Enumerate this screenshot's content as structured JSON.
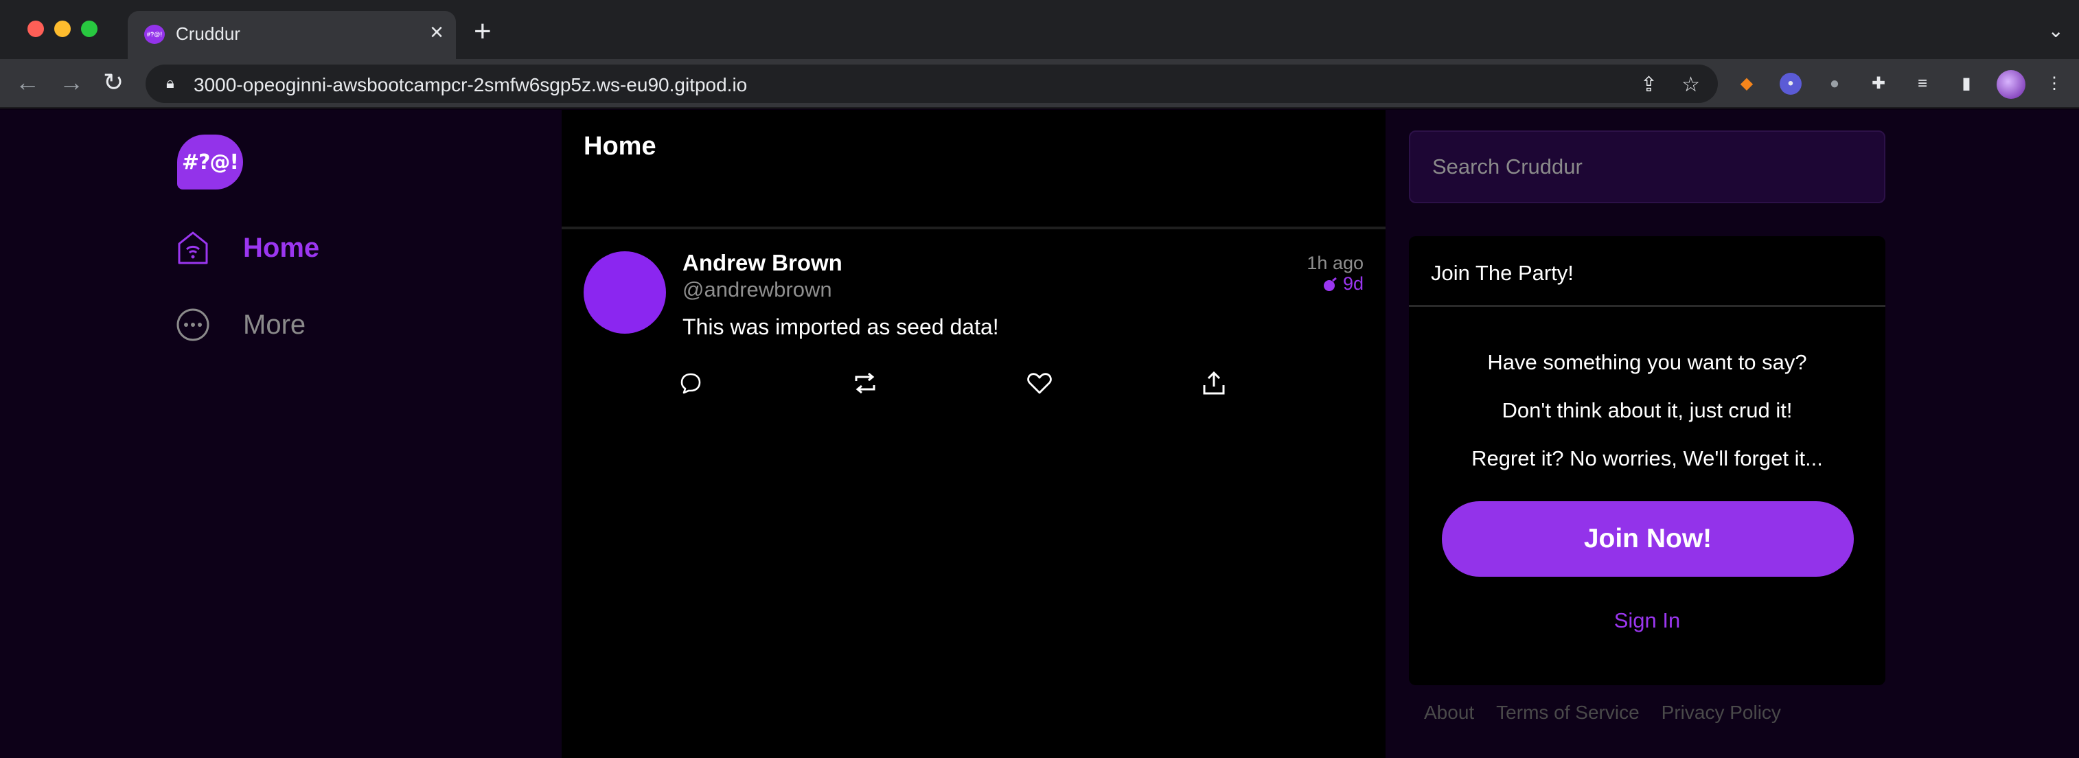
{
  "browser": {
    "tab_title": "Cruddur",
    "tab_favicon_text": "#?@!",
    "url": "3000-opeoginni-awsbootcampcr-2smfw6sgp5z.ws-eu90.gitpod.io",
    "extensions": [
      "fox-extension-icon",
      "mask-extension-icon",
      "bean-extension-icon",
      "puzzle-icon",
      "media-icon",
      "side-panel-icon",
      "profile-avatar"
    ]
  },
  "app": {
    "logo_text": "#?@!",
    "nav": [
      {
        "label": "Home",
        "active": true,
        "icon": "home-icon"
      },
      {
        "label": "More",
        "active": false,
        "icon": "more-icon"
      }
    ],
    "feed": {
      "title": "Home",
      "activities": [
        {
          "display_name": "Andrew Brown",
          "handle": "@andrewbrown",
          "message": "This was imported as seed data!",
          "created_ago": "1h ago",
          "expires_in": "9d"
        }
      ]
    },
    "search": {
      "placeholder": "Search Cruddur"
    },
    "join": {
      "title": "Join The Party!",
      "lines": [
        "Have something you want to say?",
        "Don't think about it, just crud it!",
        "Regret it? No worries, We'll forget it..."
      ],
      "button_label": "Join Now!",
      "signin_label": "Sign In"
    },
    "footer": [
      "About",
      "Terms of Service",
      "Privacy Policy"
    ]
  },
  "colors": {
    "accent": "#9333ea",
    "accent_text": "#9b36f0",
    "background": "#0d0118",
    "feed_background": "#000000"
  }
}
